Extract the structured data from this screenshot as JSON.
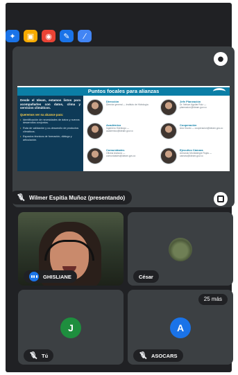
{
  "toolbar": {
    "buttons": [
      {
        "name": "sparkle-icon",
        "glyph": "✦",
        "color": "#1a73e8"
      },
      {
        "name": "folder-icon",
        "glyph": "▣",
        "color": "#f9ab00"
      },
      {
        "name": "record-icon",
        "glyph": "◉",
        "color": "#ea4335"
      },
      {
        "name": "chat-icon",
        "glyph": "✎",
        "color": "#1a73e8"
      },
      {
        "name": "effects-icon",
        "glyph": "⁄",
        "color": "#4285f4"
      }
    ]
  },
  "presenter": {
    "name_label": "Wilmer Espitia Muñoz (presentando)",
    "slide": {
      "title": "Puntos focales para alianzas",
      "intro": "Desde el Ideam, estamos listos para acompañarles con datos, clima y servicios climáticos.",
      "question": "Queremos ver su alcance para:",
      "bullets": [
        "Identificación de necesidades de datos y nuevos desarrollos conjuntos.",
        "Ruta de validación y co-desarrollo de productos climáticos.",
        "Espacios técnicos de formación, diálogo y articulación."
      ],
      "persons": [
        {
          "name": "Dirección",
          "role": "Director general — Instituto de Hidrología"
        },
        {
          "name": "Jefe Planeación",
          "role": "Dr. Nelson Aguilar Ruiz — planeacion@ideam.gov.co"
        },
        {
          "name": "Académico",
          "role": "Ingeniero Hidrólogo — academico@ideam.gov.co"
        },
        {
          "name": "Cooperación",
          "role": "Ana Osorio — cooperacion@ideam.gov.co"
        },
        {
          "name": "Comunidades",
          "role": "Oficina Asesora — comunidades@ideam.gov.co"
        },
        {
          "name": "Ejecutivo Cámara",
          "role": "Armando Montealegre Rojas — camara@ideam.gov.co"
        }
      ]
    }
  },
  "participants": [
    {
      "name": "GHISLIANE",
      "speaking": true
    },
    {
      "name": "César",
      "speaking": false
    },
    {
      "name": "Tú",
      "initial": "J",
      "avatar_color": "#1e8e3e"
    },
    {
      "name": "ASOCARS",
      "initial": "A",
      "avatar_color": "#1a73e8"
    }
  ],
  "more_count_label": "25 más"
}
